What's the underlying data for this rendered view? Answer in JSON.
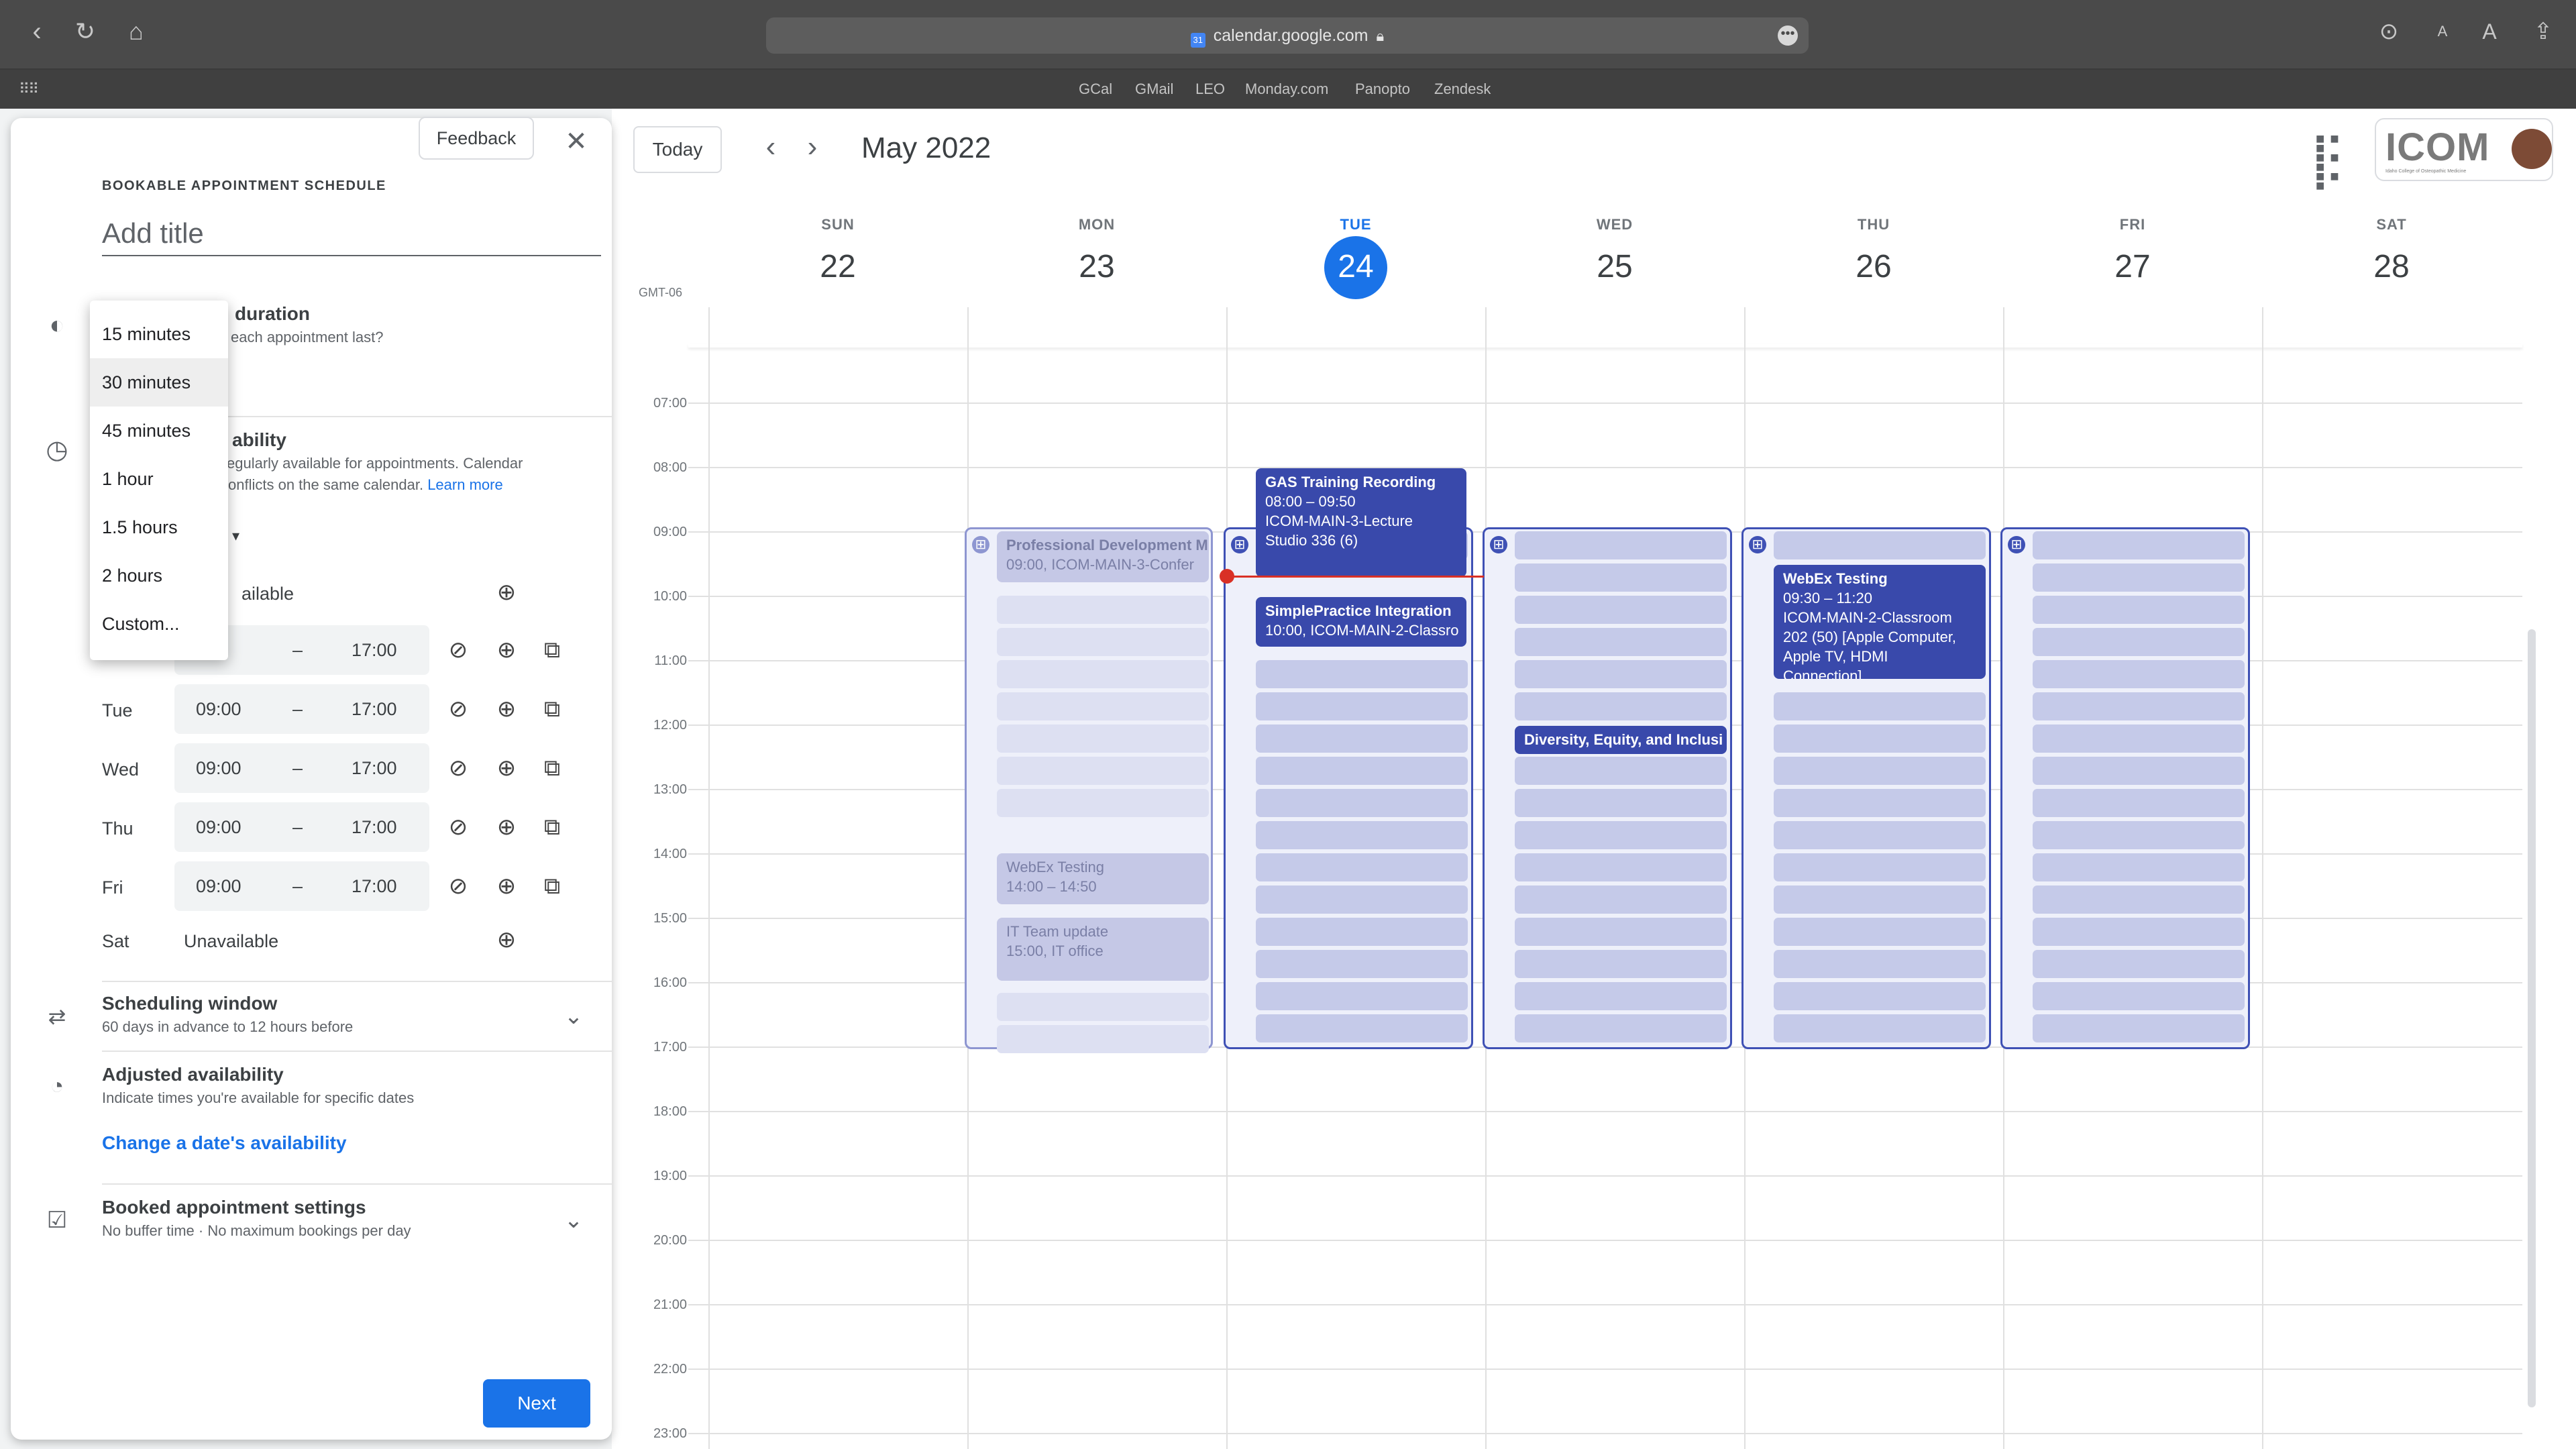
{
  "browser": {
    "url": "calendar.google.com",
    "text_size_small": "A",
    "text_size_large": "A",
    "bookmarks": [
      "GCal",
      "GMail",
      "LEO",
      "Monday.com",
      "Panopto",
      "Zendesk"
    ]
  },
  "header": {
    "today_label": "Today",
    "month_label": "May 2022",
    "timezone": "GMT-06",
    "logo_text": "ICOM",
    "logo_subtitle": "Idaho College of Osteopathic Medicine"
  },
  "days": [
    {
      "dow": "SUN",
      "num": "22"
    },
    {
      "dow": "MON",
      "num": "23"
    },
    {
      "dow": "TUE",
      "num": "24",
      "today": true
    },
    {
      "dow": "WED",
      "num": "25"
    },
    {
      "dow": "THU",
      "num": "26"
    },
    {
      "dow": "FRI",
      "num": "27"
    },
    {
      "dow": "SAT",
      "num": "28"
    }
  ],
  "hours": [
    "07:00",
    "08:00",
    "09:00",
    "10:00",
    "11:00",
    "12:00",
    "13:00",
    "14:00",
    "15:00",
    "16:00",
    "17:00",
    "18:00",
    "19:00",
    "20:00",
    "21:00",
    "22:00",
    "23:00"
  ],
  "events": {
    "mon_prof_dev": {
      "title": "Professional Development M",
      "detail": "09:00, ICOM-MAIN-3-Confer"
    },
    "mon_webex": {
      "title": "WebEx Testing",
      "detail": "14:00 – 14:50"
    },
    "mon_it": {
      "title": "IT Team update",
      "detail": "15:00, IT office"
    },
    "tue_gas": {
      "title": "GAS Training Recording",
      "time": "08:00 – 09:50",
      "loc1": "ICOM-MAIN-3-Lecture",
      "loc2": "Studio 336 (6)"
    },
    "tue_simple": {
      "title": "SimplePractice Integration",
      "detail": "10:00, ICOM-MAIN-2-Classro"
    },
    "wed_diversity": {
      "title": "Diversity, Equity, and Inclusi"
    },
    "thu_webex": {
      "title": "WebEx Testing",
      "time": "09:30 – 11:20",
      "loc1": "ICOM-MAIN-2-Classroom",
      "loc2": "202 (50) [Apple Computer,",
      "loc3": "Apple TV, HDMI",
      "loc4": "Connection]"
    }
  },
  "panel": {
    "feedback_label": "Feedback",
    "heading": "BOOKABLE APPOINTMENT SCHEDULE",
    "title_placeholder": "Add title",
    "duration_title": "duration",
    "duration_sub": "each appointment last?",
    "availability_title": "ability",
    "availability_sub1": "egularly available for appointments. Calendar",
    "availability_sub2": "onflicts on the same calendar.",
    "learn_more": "Learn more",
    "sun_unavailable": "ailable",
    "weekdays": [
      {
        "day": "",
        "start": "0",
        "end": "17:00"
      },
      {
        "day": "Tue",
        "start": "09:00",
        "end": "17:00"
      },
      {
        "day": "Wed",
        "start": "09:00",
        "end": "17:00"
      },
      {
        "day": "Thu",
        "start": "09:00",
        "end": "17:00"
      },
      {
        "day": "Fri",
        "start": "09:00",
        "end": "17:00"
      }
    ],
    "dash": "–",
    "sat_label": "Sat",
    "sat_value": "Unavailable",
    "scheduling_title": "Scheduling window",
    "scheduling_sub": "60 days in advance to 12 hours before",
    "adjusted_title": "Adjusted availability",
    "adjusted_sub": "Indicate times you're available for specific dates",
    "change_link": "Change a date's availability",
    "booked_title": "Booked appointment settings",
    "booked_sub": "No buffer time · No maximum bookings per day",
    "next_label": "Next"
  },
  "dropdown": {
    "options": [
      "15 minutes",
      "30 minutes",
      "45 minutes",
      "1 hour",
      "1.5 hours",
      "2 hours",
      "Custom..."
    ],
    "selected": "30 minutes"
  },
  "colors": {
    "accent": "#1a73e8",
    "event_dark": "#3949ab",
    "event_light": "#c5c8e6",
    "now_line": "#d93025"
  }
}
